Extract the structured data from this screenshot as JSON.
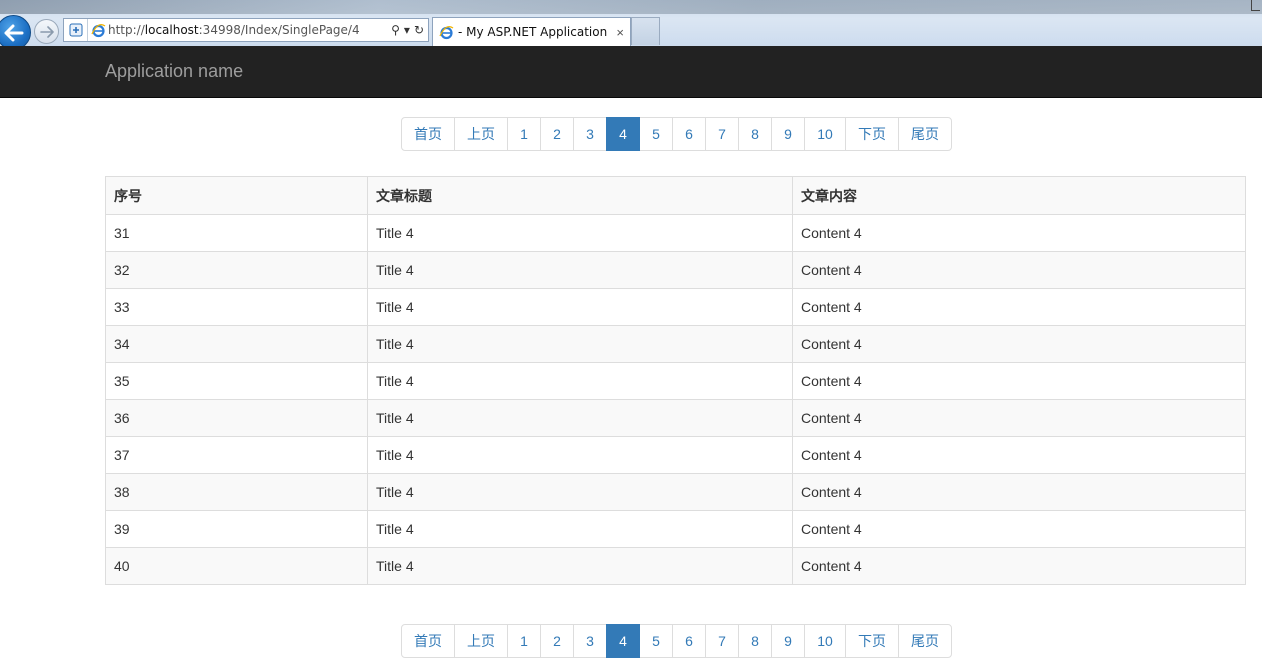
{
  "browser": {
    "url_prefix": "http://",
    "url_host": "localhost",
    "url_rest": ":34998/Index/SinglePage/4",
    "tab_title": "- My ASP.NET Application",
    "tab_close": "×",
    "search_glyph": "⚲",
    "dropdown_glyph": "▾",
    "refresh_glyph": "↻"
  },
  "navbar": {
    "brand": "Application name"
  },
  "pagination": {
    "first": "首页",
    "prev": "上页",
    "pages": [
      "1",
      "2",
      "3",
      "4",
      "5",
      "6",
      "7",
      "8",
      "9",
      "10"
    ],
    "active_page": "4",
    "next": "下页",
    "last": "尾页"
  },
  "table": {
    "headers": [
      "序号",
      "文章标题",
      "文章内容"
    ],
    "rows": [
      [
        "31",
        "Title 4",
        "Content 4"
      ],
      [
        "32",
        "Title 4",
        "Content 4"
      ],
      [
        "33",
        "Title 4",
        "Content 4"
      ],
      [
        "34",
        "Title 4",
        "Content 4"
      ],
      [
        "35",
        "Title 4",
        "Content 4"
      ],
      [
        "36",
        "Title 4",
        "Content 4"
      ],
      [
        "37",
        "Title 4",
        "Content 4"
      ],
      [
        "38",
        "Title 4",
        "Content 4"
      ],
      [
        "39",
        "Title 4",
        "Content 4"
      ],
      [
        "40",
        "Title 4",
        "Content 4"
      ]
    ]
  },
  "colors": {
    "navbar_bg": "#222222",
    "brand_text": "#9d9d9d",
    "link": "#337ab7",
    "active_page_bg": "#337ab7",
    "border": "#dddddd",
    "stripe": "#f9f9f9"
  }
}
